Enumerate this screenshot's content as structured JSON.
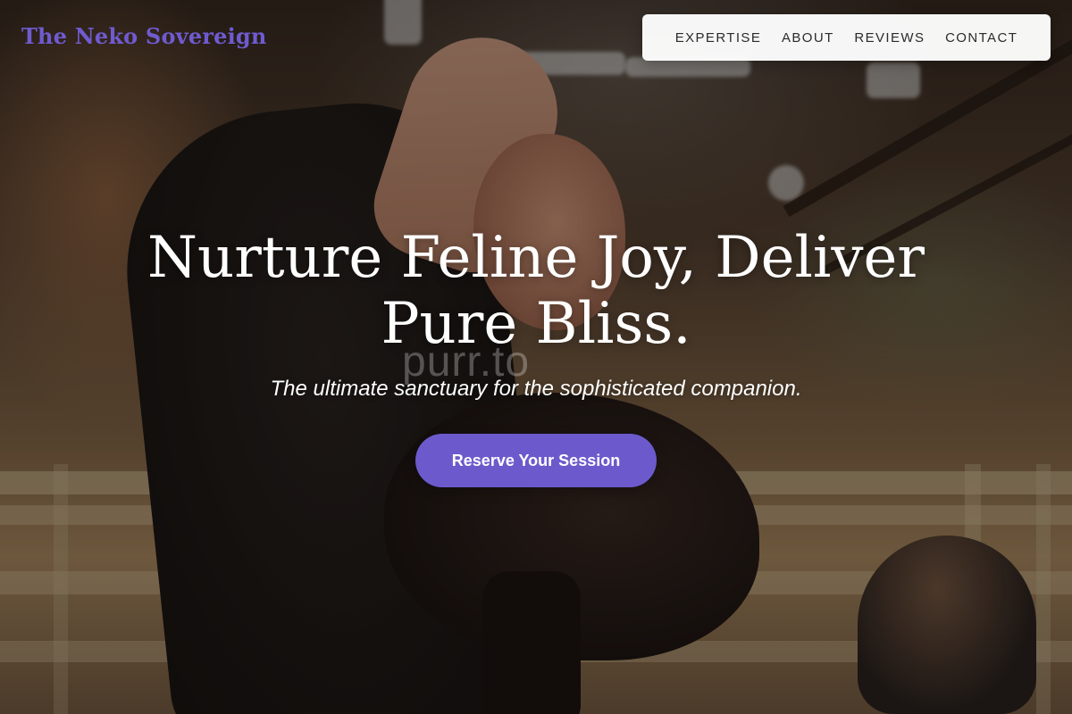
{
  "brand": {
    "name": "The Neko Sovereign"
  },
  "nav": {
    "items": [
      {
        "label": "EXPERTISE"
      },
      {
        "label": "ABOUT"
      },
      {
        "label": "REVIEWS"
      },
      {
        "label": "CONTACT"
      }
    ]
  },
  "hero": {
    "headline_line1": "Nurture Feline Joy, Deliver",
    "headline_line2": "Pure Bliss.",
    "watermark": "purr.to",
    "subtitle": "The ultimate sanctuary for the sophisticated companion.",
    "cta_label": "Reserve Your Session"
  },
  "colors": {
    "accent": "#6c5acd",
    "brand_text": "#6f5bd0",
    "nav_background": "#ffffff"
  }
}
